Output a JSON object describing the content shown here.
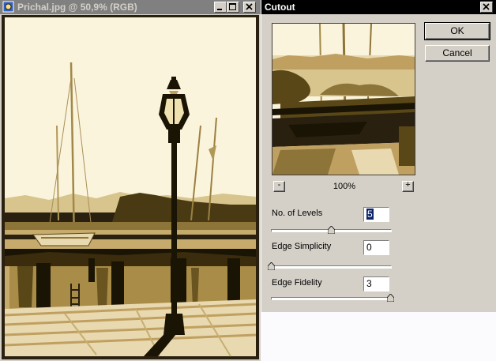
{
  "document": {
    "title": "Prichal.jpg @ 50,9% (RGB)",
    "icon": "photoshop-document-icon",
    "controls": [
      "minimize-icon",
      "maximize-icon",
      "close-icon"
    ]
  },
  "dialog": {
    "title": "Cutout",
    "zoom": "100%",
    "zoom_out": "-",
    "zoom_in": "+",
    "ok_label": "OK",
    "cancel_label": "Cancel",
    "params": [
      {
        "label": "No. of Levels",
        "value": "5",
        "slider": 0.5
      },
      {
        "label": "Edge Simplicity",
        "value": "0",
        "slider": 0.0
      },
      {
        "label": "Edge Fidelity",
        "value": "3",
        "slider": 1.0
      }
    ]
  },
  "colors": {
    "sky": "#fbf4dc",
    "sepia_light": "#e8d9b0",
    "sepia_mid": "#c0a060",
    "sepia_dark": "#5a4718",
    "ink": "#1a1404",
    "dialog_bg": "#d4d0c8",
    "active_title": "#000000",
    "inactive_title": "#808080"
  }
}
